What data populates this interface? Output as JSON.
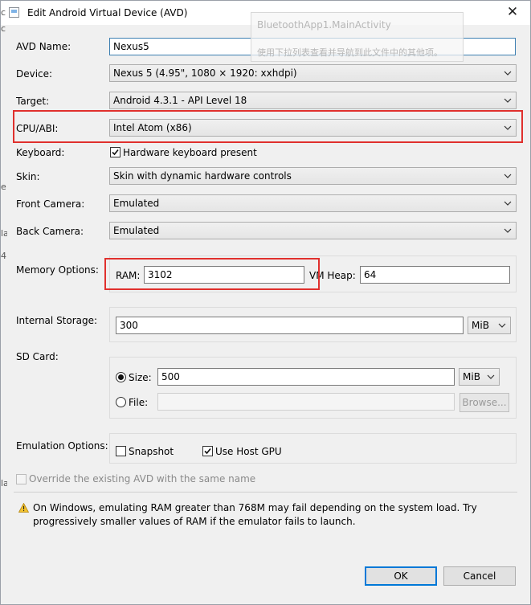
{
  "window": {
    "title": "Edit Android Virtual Device (AVD)",
    "close_glyph": "✕",
    "background_color": "#f0f0f0"
  },
  "tooltip": {
    "line1": "BluetoothApp1.MainActivity",
    "line2": "使用下拉列表查看并导航到此文件中的其他项。"
  },
  "form": {
    "avd_name": {
      "label": "AVD Name:",
      "value": "Nexus5"
    },
    "device": {
      "label": "Device:",
      "value": "Nexus 5 (4.95\", 1080 × 1920: xxhdpi)"
    },
    "target": {
      "label": "Target:",
      "value": "Android 4.3.1 - API Level 18"
    },
    "cpu_abi": {
      "label": "CPU/ABI:",
      "value": "Intel Atom (x86)"
    },
    "keyboard": {
      "label": "Keyboard:",
      "checkbox_label": "Hardware keyboard present",
      "checked": true
    },
    "skin": {
      "label": "Skin:",
      "value": "Skin with dynamic hardware controls"
    },
    "front_camera": {
      "label": "Front Camera:",
      "value": "Emulated"
    },
    "back_camera": {
      "label": "Back Camera:",
      "value": "Emulated"
    },
    "memory": {
      "label": "Memory Options:",
      "ram_label": "RAM:",
      "ram_value": "3102",
      "vm_heap_label": "VM Heap:",
      "vm_heap_value": "64"
    },
    "internal_storage": {
      "label": "Internal Storage:",
      "value": "300",
      "unit": "MiB"
    },
    "sd_card": {
      "label": "SD Card:",
      "size_label": "Size:",
      "size_value": "500",
      "size_unit": "MiB",
      "size_selected": true,
      "file_label": "File:",
      "file_value": "",
      "browse_label": "Browse..."
    },
    "emulation": {
      "label": "Emulation Options:",
      "snapshot_label": "Snapshot",
      "snapshot_checked": false,
      "host_gpu_label": "Use Host GPU",
      "host_gpu_checked": true
    },
    "override": {
      "label": "Override the existing AVD with the same name",
      "checked": false
    }
  },
  "warning": {
    "text": "On Windows, emulating RAM greater than 768M may fail depending on the system load. Try progressively smaller values of RAM if the emulator fails to launch.",
    "icon": "warning-icon"
  },
  "buttons": {
    "ok": "OK",
    "cancel": "Cancel"
  },
  "highlight_color": "#e0302d",
  "background_edge": [
    "c",
    "c",
    "e",
    "la",
    "4",
    "la"
  ]
}
